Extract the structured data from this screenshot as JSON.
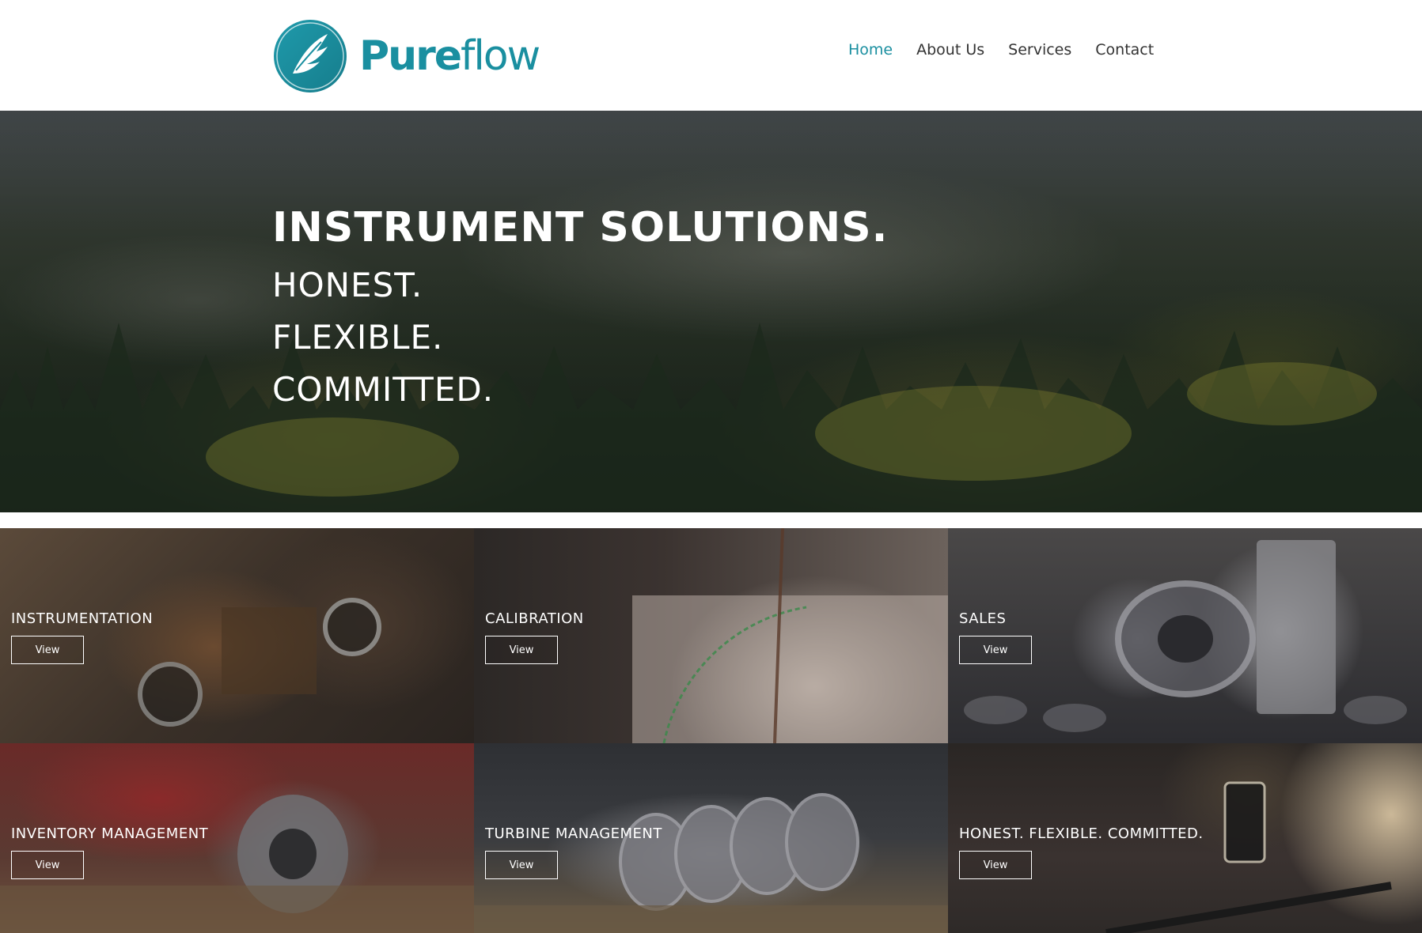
{
  "brand": {
    "name_bold": "Pure",
    "name_light": "flow",
    "logo_icon": "feather-wing-icon",
    "accent_color": "#1a8fa0"
  },
  "nav": {
    "items": [
      {
        "label": "Home",
        "active": true
      },
      {
        "label": "About Us",
        "active": false
      },
      {
        "label": "Services",
        "active": false
      },
      {
        "label": "Contact",
        "active": false
      }
    ]
  },
  "hero": {
    "title": "INSTRUMENT SOLUTIONS.",
    "lines": [
      "HONEST.",
      "FLEXIBLE.",
      "COMMITTED."
    ]
  },
  "tiles": [
    {
      "label": "INSTRUMENTATION",
      "button": "View"
    },
    {
      "label": "CALIBRATION",
      "button": "View"
    },
    {
      "label": "SALES",
      "button": "View"
    },
    {
      "label": "INVENTORY MANAGEMENT",
      "button": "View"
    },
    {
      "label": "TURBINE MANAGEMENT",
      "button": "View"
    },
    {
      "label": "HONEST. FLEXIBLE. COMMITTED.",
      "button": "View"
    }
  ]
}
